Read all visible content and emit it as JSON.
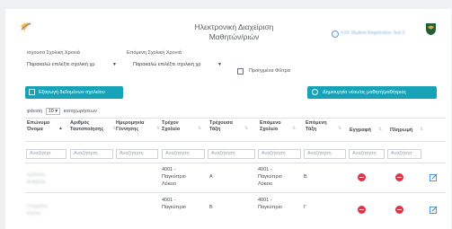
{
  "header": {
    "title_line1": "Ηλεκτρονική Διαχείριση",
    "title_line2": "Μαθητών/ριών",
    "user_label": "ΧΧΧ Student Registration Test 3",
    "logo_left": "shield-crest-icon",
    "logo_right": "cyprus-emblem-icon"
  },
  "filters": {
    "current_year_label": "ισχουσα Σχολική Χρονιά",
    "current_year_value": "Παρακαλώ επιλέξτε σχολική χρ",
    "next_year_label": "Επόμενη Σχολική Χρονιά",
    "next_year_value": "Παρακαλώ επιλέξτε σχολική χρ",
    "advanced_filter_label": "Προηγμένα Φίλτρα"
  },
  "buttons": {
    "export": "Εξαγωγή δεδομένων σχολείου",
    "create": "Δημιουργία νέου/ας μαθητή/μαθήτριας"
  },
  "paging": {
    "show_prefix": "φάνιση",
    "page_size": "10",
    "show_suffix": "καταχωρήσεων"
  },
  "table": {
    "headers": [
      {
        "line1": "Επώνυμο",
        "line2": "Όνομα"
      },
      {
        "line1": "Αριθμός",
        "line2": "Ταυτοποίησης"
      },
      {
        "line1": "Ημερομηνία",
        "line2": "Γέννησης"
      },
      {
        "line1": "Τρέχον",
        "line2": "Σχολείο"
      },
      {
        "line1": "Τρέχουσα",
        "line2": "Τάξη"
      },
      {
        "line1": "Επόμενο",
        "line2": "Σχολείο"
      },
      {
        "line1": "Επόμενη",
        "line2": "Τάξη"
      },
      {
        "line1": "Εγγραφή",
        "line2": ""
      },
      {
        "line1": "Πληρωμή",
        "line2": ""
      }
    ],
    "search_placeholder": "Αναζήτηση",
    "search_placeholder_short": "Αναζήτησ",
    "rows": [
      {
        "name_line1": "Ιωάννου",
        "name_line2": "Ανδρέας",
        "current_school": [
          "4001 -",
          "Παγκύπριο",
          "Λύκειο"
        ],
        "current_class": "Α",
        "next_school": [
          "4001 -",
          "Παγκύπριο",
          "Λύκειο"
        ],
        "next_class": "Β",
        "registration_status": "x-circle-icon",
        "edit_icon": "edit-icon"
      },
      {
        "name_line1": "Γεωργίου",
        "name_line2": "Ελένη",
        "current_school": [
          "4001 -",
          "Παγκύπριο"
        ],
        "current_class": "Β",
        "next_school": [
          "4001 -",
          "Παγκύπριο"
        ],
        "next_class": "Γ",
        "registration_status": "x-circle-icon",
        "edit_icon": "edit-icon"
      }
    ]
  },
  "colors": {
    "accent": "#17a2b8",
    "danger": "#dc3545",
    "link": "#5b9bd5"
  }
}
